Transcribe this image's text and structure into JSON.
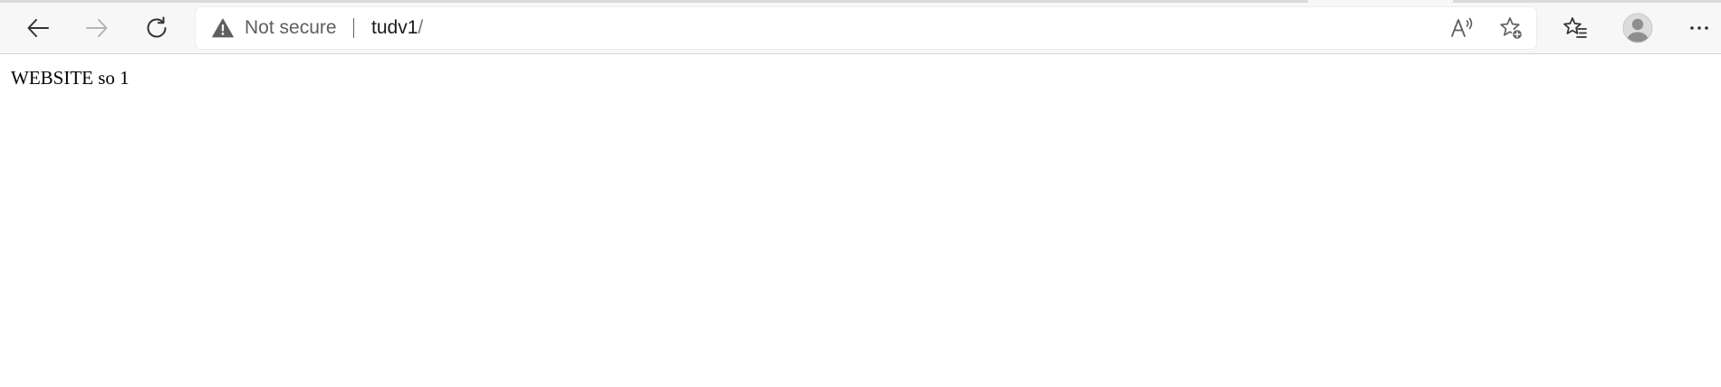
{
  "browser": {
    "toolbar": {
      "back_icon": "arrow-left-icon",
      "forward_icon": "arrow-right-icon",
      "refresh_icon": "refresh-icon",
      "favorites_icon": "favorites-list-icon",
      "profile_icon": "profile-avatar-icon",
      "menu_icon": "more-horizontal-icon"
    },
    "address_bar": {
      "security_icon": "warning-triangle-icon",
      "security_label": "Not secure",
      "url_host": "tudv1",
      "url_path": "/",
      "read_aloud_icon": "read-aloud-icon",
      "add_favorite_icon": "star-add-icon"
    },
    "colors": {
      "toolbar_bg": "#f7f7f7",
      "omnibox_bg": "#ffffff",
      "icon": "#333333",
      "icon_disabled": "#b5b5b5",
      "muted_text": "#5f5f5f"
    }
  },
  "page": {
    "body_text": "WEBSITE so 1"
  }
}
